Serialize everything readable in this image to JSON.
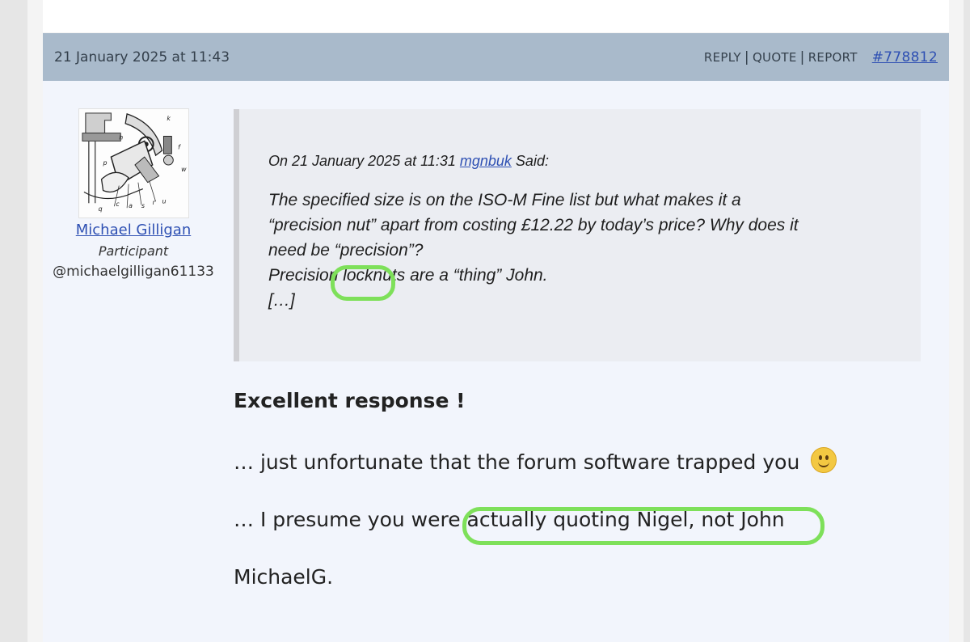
{
  "post": {
    "date": "21 January 2025 at 11:43",
    "actions": {
      "reply": "REPLY",
      "quote": "QUOTE",
      "report": "REPORT",
      "separator": "|"
    },
    "id": "#778812"
  },
  "author": {
    "name": "Michael Gilligan",
    "role": "Participant",
    "handle": "@michaelgilligan61133"
  },
  "quote": {
    "cite_prefix": "On 21 January 2025 at 11:31",
    "cite_user": "mgnbuk",
    "cite_suffix": "Said:",
    "line1": "The specified size is on the ISO-M Fine list but what makes it a",
    "line2": "“precision nut” apart from costing £12.22 by today’s price? Why does it",
    "line3": "need be “precision”?",
    "line4": "Precision locknuts are a “thing” John.",
    "line5": "[…]"
  },
  "reply": {
    "title": "Excellent response !",
    "p1": "… just unfortunate that the forum software trapped you",
    "p2": "… I presume you were actually quoting Nigel, not John",
    "signature": "MichaelG."
  },
  "colors": {
    "header_bg": "#a9bacb",
    "body_bg": "#f2f5fc",
    "link": "#2e50b3",
    "highlight": "#7ee05a"
  }
}
